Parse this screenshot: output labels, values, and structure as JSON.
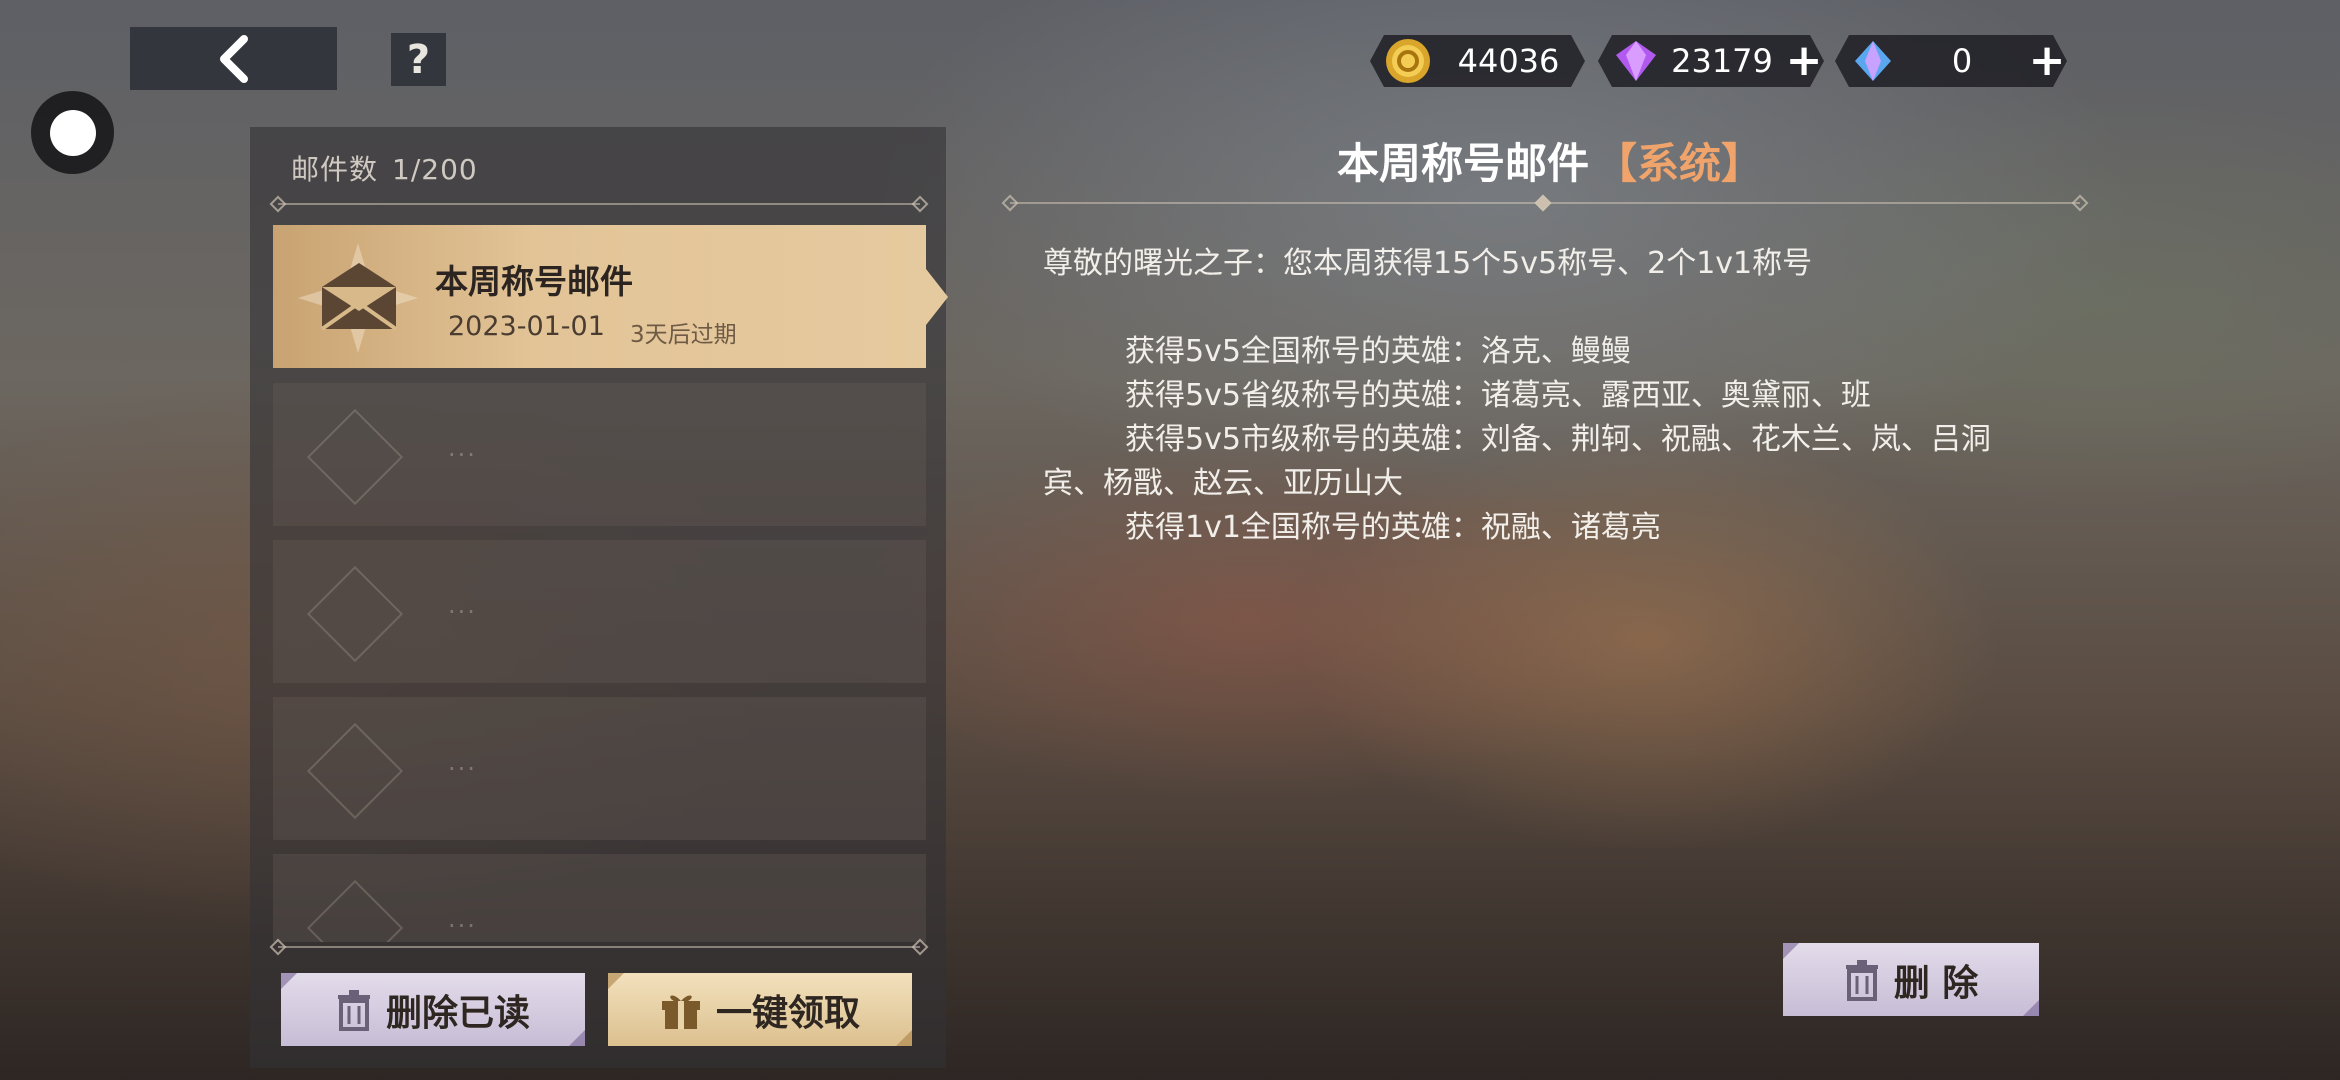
{
  "top_bar": {
    "currencies": [
      {
        "name": "gold-coin",
        "value": "44036",
        "has_plus": false
      },
      {
        "name": "purple-diamond",
        "value": "23179",
        "has_plus": true
      },
      {
        "name": "blue-crystal",
        "value": "0",
        "has_plus": true
      }
    ],
    "help_label": "?"
  },
  "mail_list": {
    "count_label": "邮件数",
    "count_value": "1/200",
    "active_mail": {
      "title": "本周称号邮件",
      "date": "2023-01-01",
      "expire": "3天后过期"
    },
    "placeholder_dots": "···"
  },
  "buttons": {
    "delete_read": "删除已读",
    "claim_all": "一键领取",
    "delete": "删 除"
  },
  "detail": {
    "title": "本周称号邮件",
    "tag": "【系统】",
    "greeting": "尊敬的曙光之子：您本周获得15个5v5称号、2个1v1称号",
    "lines": [
      "获得5v5全国称号的英雄：洛克、鳗鳗",
      "获得5v5省级称号的英雄：诸葛亮、露西亚、奥黛丽、班",
      "获得5v5市级称号的英雄：刘备、荆轲、祝融、花木兰、岚、吕洞宾、杨戬、赵云、亚历山大",
      "获得1v1全国称号的英雄：祝融、诸葛亮"
    ]
  }
}
